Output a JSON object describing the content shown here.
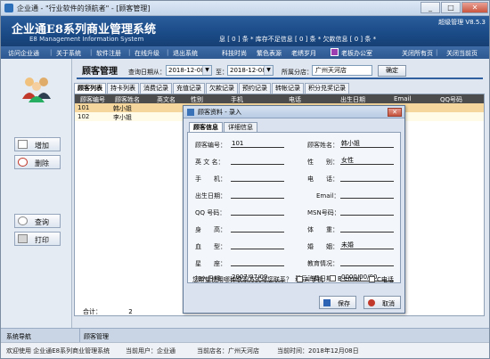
{
  "window": {
    "title": "企业通 - \"行业软件的领航者\" - [顾客管理]",
    "controls": [
      "_",
      "□",
      "✕"
    ]
  },
  "banner": {
    "brand": "企业通E8系列商业管理系统",
    "brand_en": "E8 Management Information System",
    "user": "超级管理 V8.5.3",
    "notices": "息 [ 0 ] 条  * 库存不足信息 [ 0 ] 条  * 欠款信息 [ 0 ] 条  *"
  },
  "nav": {
    "items": [
      "访问企业通",
      "关于系统",
      "软件注册",
      "在线升级",
      "退出系统",
      "科技时尚",
      "繁色表源",
      "老绣岁月",
      "老板办公室",
      "关闭所有页",
      "关闭当前页"
    ]
  },
  "left": {
    "add": "增加",
    "delete": "删除",
    "query": "查询",
    "print": "打印"
  },
  "main": {
    "title": "顾客管理",
    "query_date_label": "查询日期从：",
    "date_from": "2018-12-08",
    "to_label": "至：",
    "date_to": "2018-12-08",
    "branch_label": "所属分店：",
    "branch": "广州天河店",
    "confirm": "确定",
    "tabs": [
      "顾客列表",
      "持卡列表",
      "消费记录",
      "充值记录",
      "欠款记录",
      "预约记录",
      "转帐记录",
      "积分兑奖记录"
    ],
    "columns": [
      "顾客编号",
      "顾客姓名",
      "英文名",
      "性别",
      "手机",
      "电话",
      "出生日期",
      "Email",
      "QQ号码"
    ],
    "rows": [
      {
        "id": "101",
        "name": "韩小姐"
      },
      {
        "id": "102",
        "name": "李小姐"
      }
    ],
    "total_label": "合计：",
    "total_value": "2"
  },
  "dialog": {
    "title": "顾客资料 - 录入",
    "close": "✕",
    "tabs": [
      "顾客信息",
      "详细信息"
    ],
    "fields": {
      "id_label": "顾客编号：",
      "id_value": "101",
      "name_label": "顾客姓名：",
      "name_value": "韩小姐",
      "en_label": "英 文 名：",
      "en_value": "",
      "sex_label": "性　　别：",
      "sex_value": "女性",
      "mobile_label": "手　　机：",
      "mobile_value": "",
      "phone_label": "电　　话：",
      "phone_value": "",
      "birth_label": "出生日期：",
      "birth_value": "",
      "email_label": "Email：",
      "email_value": "",
      "qq_label": "QQ 号码：",
      "qq_value": "",
      "msn_label": "MSN号码：",
      "msn_value": "",
      "height_label": "身　　高：",
      "height_value": "",
      "weight_label": "体　　重：",
      "weight_value": "",
      "blood_label": "血　　型：",
      "blood_value": "",
      "marital_label": "婚　　姻：",
      "marital_value": "未婚",
      "star_label": "星　　座：",
      "star_value": "",
      "edu_label": "教育情况：",
      "edu_value": "",
      "join_label": "加入日期：",
      "join_value": "2007/07/09",
      "last_label": "最后消费日期：",
      "last_value": "0000/00/00"
    },
    "contact_question": "您希望使用哪种联系方式与您联系？",
    "contact_options": [
      "A 手机",
      "B email",
      "C电话"
    ],
    "save": "保存",
    "cancel": "取消"
  },
  "status": {
    "nav_label": "系统导航",
    "current_page": "顾客管理",
    "welcome": "欢迎使用 企业通E8系列商业管理系统",
    "current_user": "当前用户：企业通",
    "current_store": "当前店名：广州天河店",
    "current_time": "当前时间：2018年12月08日"
  },
  "colors": {
    "banner": "#1a4a86",
    "selected_row": "#f5d79e",
    "grid_header": "#4c4c4c"
  }
}
